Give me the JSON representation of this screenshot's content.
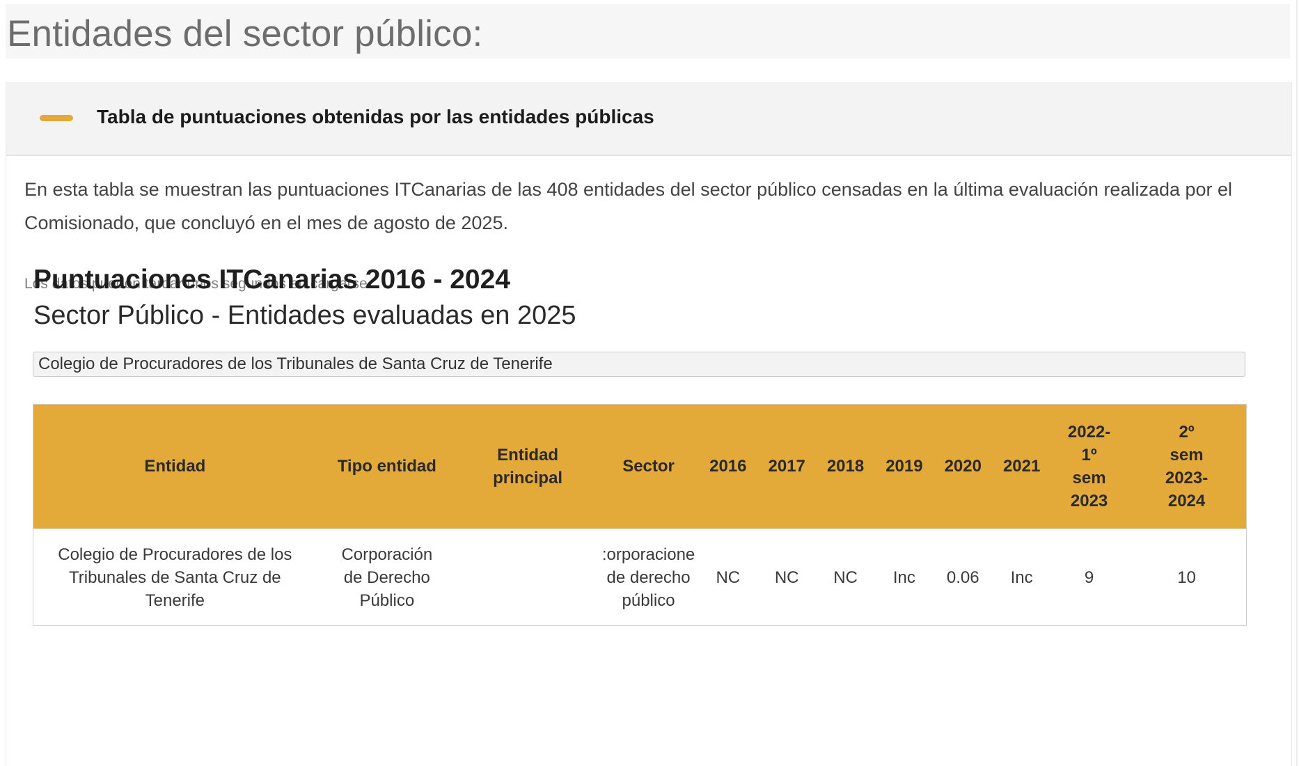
{
  "page": {
    "heading": "Entidades del sector público:"
  },
  "panel": {
    "title": "Tabla de puntuaciones obtenidas por las entidades públicas",
    "intro": "En esta tabla se muestran las puntuaciones ITCanarias de las 408 entidades del sector público censadas en la última evaluación realizada por el Comisionado, que concluyó en el mes de agosto de 2025.",
    "loading_note": "Los datos pueden tardar unos segundos en cargarse..."
  },
  "report": {
    "title": "Puntuaciones ITCanarias 2016 - 2024",
    "subtitle": "Sector Público - Entidades evaluadas en 2025",
    "filter_value": "Colegio de Procuradores de los Tribunales de Santa Cruz de Tenerife"
  },
  "table": {
    "columns": [
      "Entidad",
      "Tipo entidad",
      "Entidad principal",
      "Sector",
      "2016",
      "2017",
      "2018",
      "2019",
      "2020",
      "2021",
      "2022-1º sem 2023",
      "2º sem 2023-2024"
    ],
    "column_lines": {
      "entidad_principal": [
        "Entidad",
        "principal"
      ],
      "period_2022": [
        "2022-",
        "1º",
        "sem",
        "2023"
      ],
      "period_2023": [
        "2º",
        "sem",
        "2023-",
        "2024"
      ]
    },
    "rows": [
      {
        "entidad": "Colegio de Procuradores de los Tribunales de Santa Cruz de Tenerife",
        "tipo_entidad": "Corporación de Derecho Público",
        "entidad_principal": "",
        "sector": [
          ":orporacione",
          "de derecho",
          "público"
        ],
        "y2016": "NC",
        "y2017": "NC",
        "y2018": "NC",
        "y2019": "Inc",
        "y2020": "0.06",
        "y2021": "Inc",
        "p2022_2023": "9",
        "p2023_2024": "10"
      }
    ]
  },
  "colors": {
    "accent": "#e3aa3a",
    "heading_text": "#6d6d6d",
    "panel_header_bg": "#f3f3f3"
  }
}
